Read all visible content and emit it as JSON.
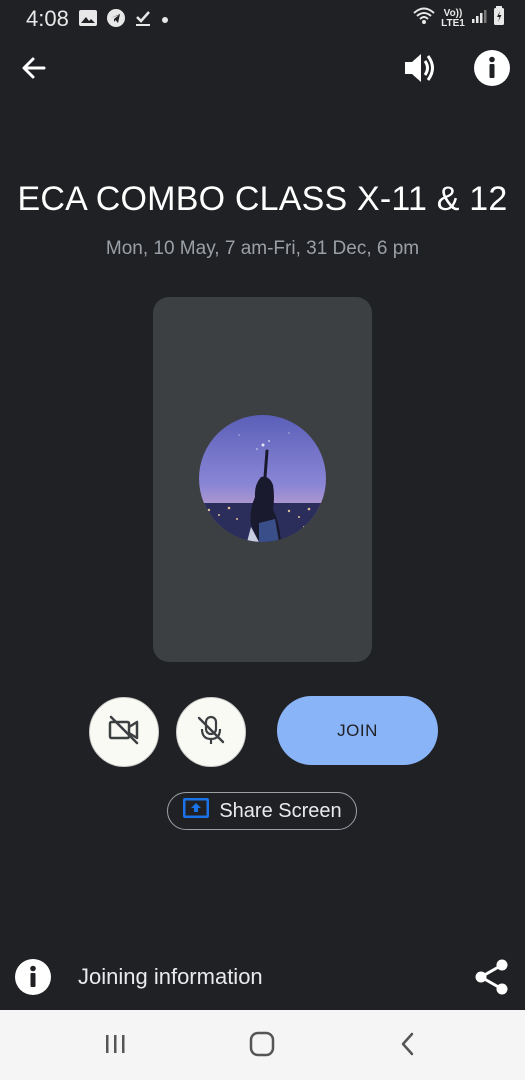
{
  "status_bar": {
    "time": "4:08",
    "network_label": "Vo)) LTE1"
  },
  "meeting": {
    "title": "ECA COMBO CLASS X-11 & 12",
    "time_range": "Mon, 10 May, 7 am-Fri, 31 Dec, 6 pm"
  },
  "controls": {
    "join_label": "JOIN",
    "share_screen_label": "Share Screen"
  },
  "footer": {
    "joining_info_label": "Joining information"
  },
  "colors": {
    "background": "#202124",
    "preview_bg": "#3c4043",
    "join_button": "#8ab4f8",
    "secondary_text": "#9aa0a6",
    "share_icon_blue": "#1a73e8"
  },
  "icons": [
    "back-arrow-icon",
    "speaker-icon",
    "info-icon",
    "camera-off-icon",
    "mic-off-icon",
    "screen-share-icon",
    "share-icon",
    "recents-icon",
    "home-icon",
    "nav-back-icon"
  ]
}
